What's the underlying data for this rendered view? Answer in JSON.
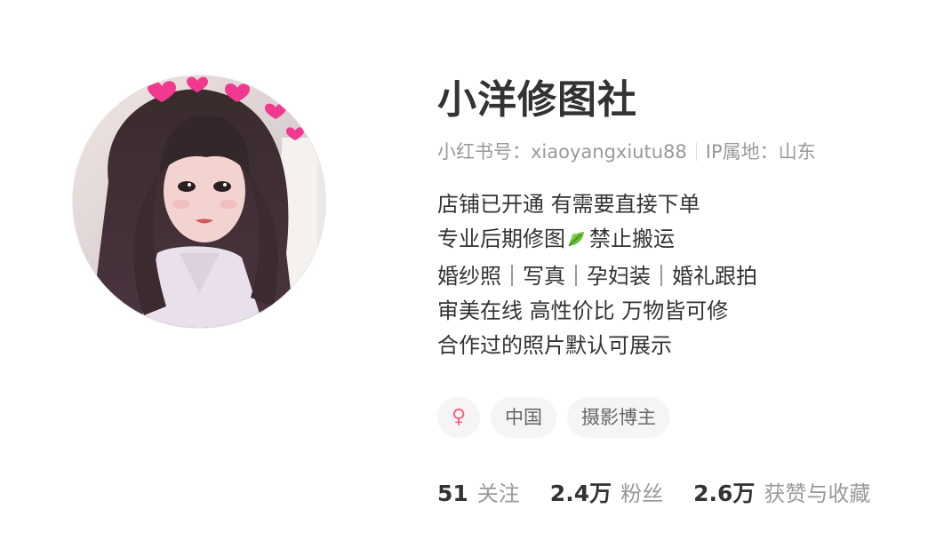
{
  "profile": {
    "nickname": "小洋修图社",
    "id_text": "小红书号：xiaoyangxiutu88",
    "ip_text": "IP属地：山东",
    "bio": [
      "店铺已开通 有需要直接下单",
      "专业后期修图",
      "禁止搬运",
      "婚纱照｜写真｜孕妇装｜婚礼跟拍",
      "审美在线 高性价比 万物皆可修",
      "合作过的照片默认可展示"
    ],
    "leaf_icon": "leaf-emoji-icon",
    "tags": {
      "gender_symbol": "♀",
      "gender_icon": "female-icon",
      "location": "中国",
      "category": "摄影博主"
    },
    "stats": {
      "following_num": "51",
      "following_label": "关注",
      "followers_num": "2.4万",
      "followers_label": "粉丝",
      "likes_num": "2.6万",
      "likes_label": "获赞与收藏"
    }
  },
  "colors": {
    "text_primary": "#333333",
    "text_secondary": "#999999",
    "tag_bg": "#f5f5f5",
    "female_accent": "#ff5c7a",
    "heart_pink": "#f0398f"
  }
}
